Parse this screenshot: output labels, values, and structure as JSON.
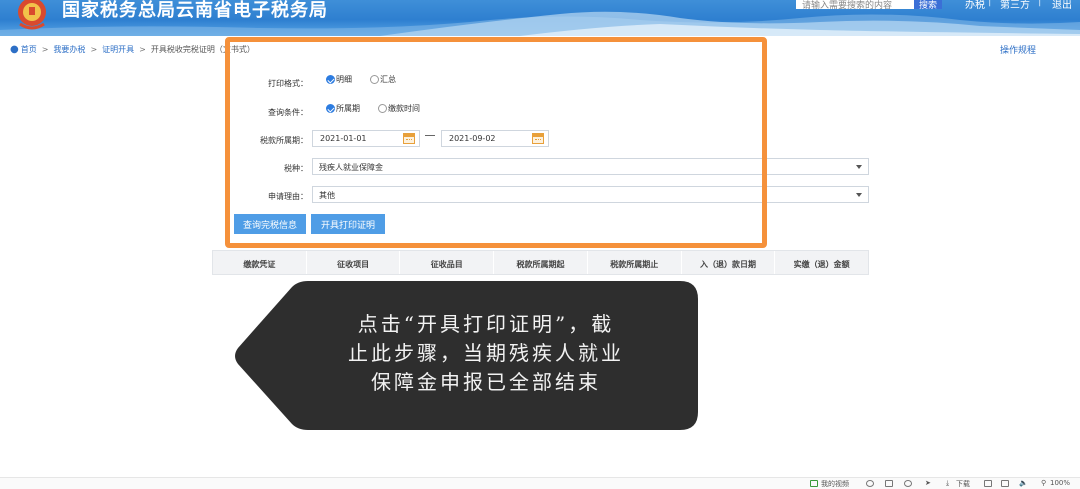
{
  "header": {
    "site_title": "国家税务总局云南省电子税务局",
    "search_placeholder": "请输入需要搜索的内容",
    "search_button": "搜索",
    "links": [
      "办税",
      "第三方",
      "退出"
    ]
  },
  "breadcrumb": {
    "items": [
      "首页",
      "我要办税",
      "证明开具",
      "开具税收完税证明（文书式）"
    ],
    "separator": ">"
  },
  "operation_rules": "操作规程",
  "form": {
    "print_format": {
      "label": "打印格式：",
      "options": [
        "明细",
        "汇总"
      ],
      "selected": "明细"
    },
    "query_condition": {
      "label": "查询条件：",
      "options": [
        "所属期",
        "缴款时间"
      ],
      "selected": "所属期"
    },
    "tax_period": {
      "label": "税款所属期：",
      "start": "2021-01-01",
      "end": "2021-09-02"
    },
    "tax_type": {
      "label": "税种：",
      "value": "残疾人就业保障金"
    },
    "reason": {
      "label": "申请理由：",
      "value": "其他"
    },
    "buttons": {
      "query": "查询完税信息",
      "print": "开具打印证明"
    }
  },
  "table": {
    "columns": [
      "缴款凭证",
      "征收项目",
      "征收品目",
      "税款所属期起",
      "税款所属期止",
      "入（退）款日期",
      "实缴（退）金额"
    ]
  },
  "callout": {
    "lines": [
      "点击“开具打印证明”，截",
      "止此步骤，当期残疾人就业",
      "保障金申报已全部结束"
    ]
  },
  "footer": {
    "video": "我的视频",
    "download": "下载",
    "zoom": "100%"
  },
  "colors": {
    "highlight": "#f5913b",
    "button": "#4f9de6",
    "link": "#2d6fc6",
    "callout_bg": "#2e2e2e"
  }
}
